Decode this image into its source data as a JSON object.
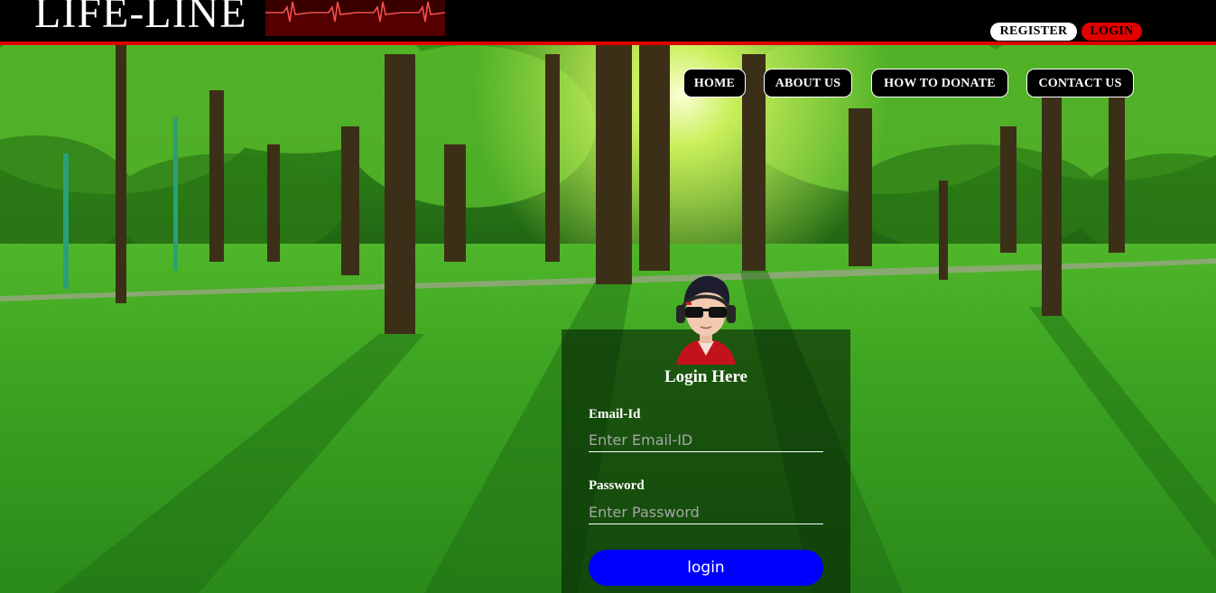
{
  "header": {
    "logo_text": "LIFE-LINE",
    "register_label": "REGISTER",
    "login_label": "LOGIN"
  },
  "nav": {
    "home": "HOME",
    "about": "ABOUT US",
    "donate": "HOW TO DONATE",
    "contact": "CONTACT US"
  },
  "login_form": {
    "title": "Login Here",
    "email_label": "Email-Id",
    "email_placeholder": "Enter Email-ID",
    "email_value": "",
    "password_label": "Password",
    "password_placeholder": "Enter Password",
    "password_value": "",
    "submit_label": "login"
  },
  "colors": {
    "topbar": "#000000",
    "accent_red": "#e00000",
    "submit_blue": "#0000ff"
  },
  "icons": {
    "heartbeat": "ekg-heartbeat-line-icon",
    "avatar": "user-avatar-with-sunglasses"
  }
}
